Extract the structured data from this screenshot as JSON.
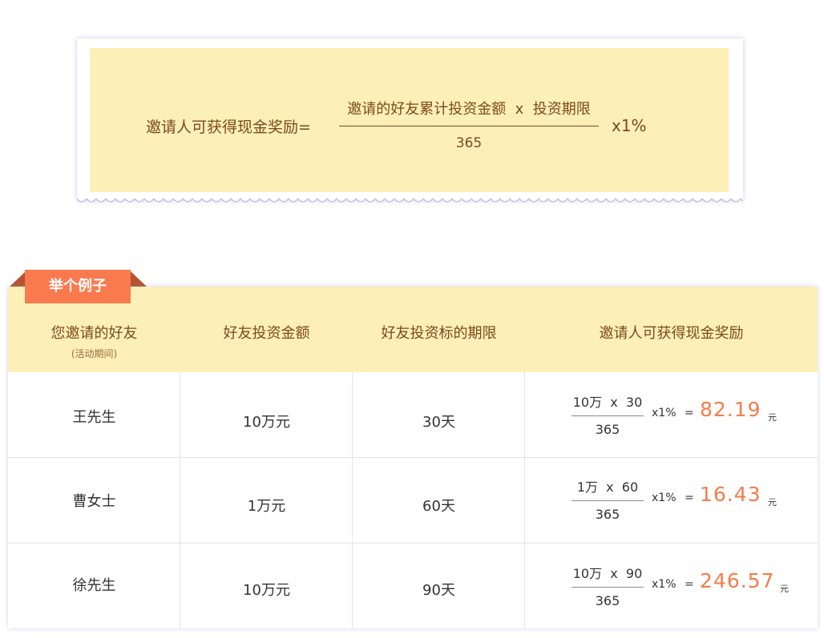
{
  "formula": {
    "label": "邀请人可获得现金奖励=",
    "numerator": "邀请的好友累计投资金额  x  投资期限",
    "denominator": "365",
    "multiplier": "x1%"
  },
  "example": {
    "tab_label": "举个例子",
    "headers": {
      "friend": "您邀请的好友",
      "friend_sub": "(活动期间)",
      "amount": "好友投资金额",
      "term": "好友投资标的期限",
      "reward": "邀请人可获得现金奖励"
    },
    "rows": [
      {
        "name": "王先生",
        "amount": "10万元",
        "term": "30天",
        "calc_numerator": "10万  x  30",
        "calc_denominator": "365",
        "calc_multiplier": "x1%",
        "equals": "=",
        "result": "82.19",
        "unit": "元"
      },
      {
        "name": "曹女士",
        "amount": "1万元",
        "term": "60天",
        "calc_numerator": "1万  x  60",
        "calc_denominator": "365",
        "calc_multiplier": "x1%",
        "equals": "=",
        "result": "16.43",
        "unit": "元"
      },
      {
        "name": "徐先生",
        "amount": "10万元",
        "term": "90天",
        "calc_numerator": "10万  x  90",
        "calc_denominator": "365",
        "calc_multiplier": "x1%",
        "equals": "=",
        "result": "246.57",
        "unit": "元"
      }
    ]
  },
  "colors": {
    "header_bg": "#fdefb8",
    "header_text": "#7b4a1a",
    "tab_bg": "#f97a4e",
    "tab_fold": "#b5552f",
    "result": "#f57c4a",
    "card_shadow": "#8282dc"
  }
}
